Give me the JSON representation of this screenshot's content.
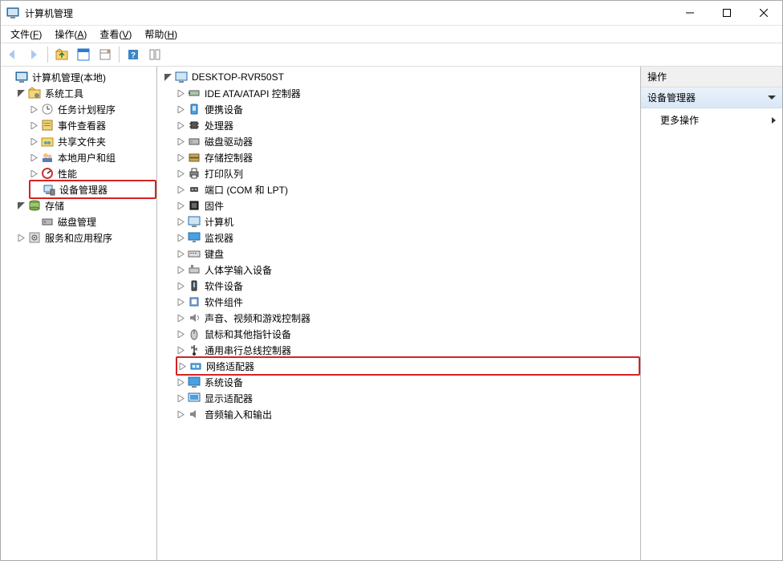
{
  "title": "计算机管理",
  "menu": {
    "file": {
      "label": "文件",
      "access": "F"
    },
    "action": {
      "label": "操作",
      "access": "A"
    },
    "view": {
      "label": "查看",
      "access": "V"
    },
    "help": {
      "label": "帮助",
      "access": "H"
    }
  },
  "left_tree": {
    "root": "计算机管理(本地)",
    "system_tools": "系统工具",
    "task_scheduler": "任务计划程序",
    "event_viewer": "事件查看器",
    "shared_folders": "共享文件夹",
    "local_users_groups": "本地用户和组",
    "performance": "性能",
    "device_manager": "设备管理器",
    "storage": "存储",
    "disk_management": "磁盘管理",
    "services_apps": "服务和应用程序"
  },
  "devices": {
    "computer": "DESKTOP-RVR50ST",
    "ide": "IDE ATA/ATAPI 控制器",
    "portable_devices": "便携设备",
    "processors": "处理器",
    "disk_drives": "磁盘驱动器",
    "storage_controllers": "存储控制器",
    "print_queues": "打印队列",
    "ports": "端口 (COM 和 LPT)",
    "firmware": "固件",
    "computer_cat": "计算机",
    "monitors": "监视器",
    "keyboards": "键盘",
    "hid": "人体学输入设备",
    "software_devices": "软件设备",
    "software_components": "软件组件",
    "sound": "声音、视频和游戏控制器",
    "mice": "鼠标和其他指针设备",
    "usb": "通用串行总线控制器",
    "network_adapters": "网络适配器",
    "system_devices": "系统设备",
    "display_adapters": "显示适配器",
    "audio_io": "音频输入和输出"
  },
  "right": {
    "header": "操作",
    "category": "设备管理器",
    "item1": "更多操作"
  }
}
